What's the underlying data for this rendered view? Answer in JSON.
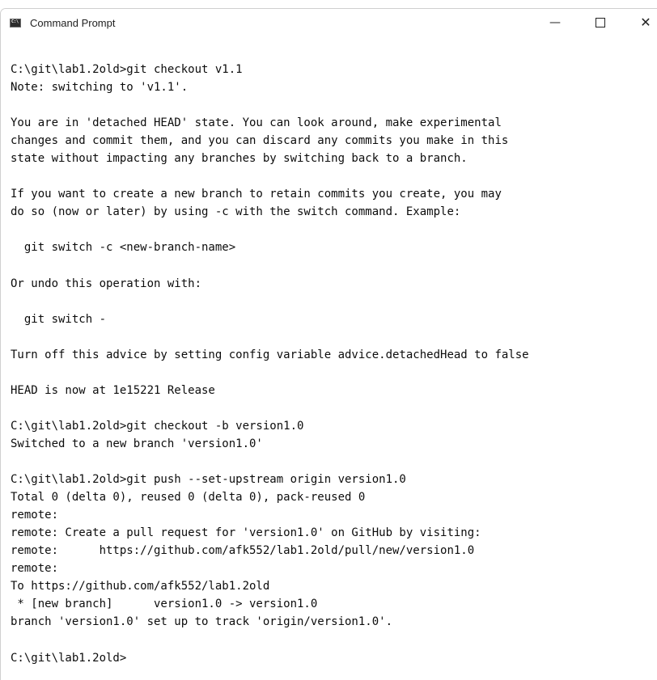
{
  "window": {
    "title": "Command Prompt",
    "icon": "cmd-icon",
    "controls": {
      "minimize": "—",
      "maximize": "maximize-icon",
      "close": "✕"
    }
  },
  "console": {
    "lines": [
      "C:\\git\\lab1.2old>git checkout v1.1",
      "Note: switching to 'v1.1'.",
      "",
      "You are in 'detached HEAD' state. You can look around, make experimental",
      "changes and commit them, and you can discard any commits you make in this",
      "state without impacting any branches by switching back to a branch.",
      "",
      "If you want to create a new branch to retain commits you create, you may",
      "do so (now or later) by using -c with the switch command. Example:",
      "",
      "  git switch -c <new-branch-name>",
      "",
      "Or undo this operation with:",
      "",
      "  git switch -",
      "",
      "Turn off this advice by setting config variable advice.detachedHead to false",
      "",
      "HEAD is now at 1e15221 Release",
      "",
      "C:\\git\\lab1.2old>git checkout -b version1.0",
      "Switched to a new branch 'version1.0'",
      "",
      "C:\\git\\lab1.2old>git push --set-upstream origin version1.0",
      "Total 0 (delta 0), reused 0 (delta 0), pack-reused 0",
      "remote:",
      "remote: Create a pull request for 'version1.0' on GitHub by visiting:",
      "remote:      https://github.com/afk552/lab1.2old/pull/new/version1.0",
      "remote:",
      "To https://github.com/afk552/lab1.2old",
      " * [new branch]      version1.0 -> version1.0",
      "branch 'version1.0' set up to track 'origin/version1.0'.",
      "",
      "C:\\git\\lab1.2old>"
    ]
  }
}
